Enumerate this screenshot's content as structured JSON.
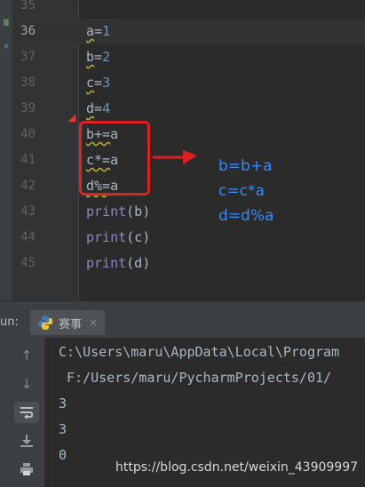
{
  "editor": {
    "lines": [
      {
        "num": "35",
        "parts": []
      },
      {
        "num": "36",
        "parts": [
          {
            "t": "a",
            "c": "warn"
          },
          {
            "t": "=",
            "c": ""
          },
          {
            "t": "1",
            "c": "num"
          }
        ]
      },
      {
        "num": "37",
        "parts": [
          {
            "t": "b",
            "c": "warn"
          },
          {
            "t": "=",
            "c": ""
          },
          {
            "t": "2",
            "c": "num"
          }
        ]
      },
      {
        "num": "38",
        "parts": [
          {
            "t": "c",
            "c": "warn"
          },
          {
            "t": "=",
            "c": ""
          },
          {
            "t": "3",
            "c": "num"
          }
        ]
      },
      {
        "num": "39",
        "parts": [
          {
            "t": "d",
            "c": "warn"
          },
          {
            "t": "=",
            "c": ""
          },
          {
            "t": "4",
            "c": "num"
          }
        ]
      },
      {
        "num": "40",
        "parts": [
          {
            "t": "b+=",
            "c": "warn"
          },
          {
            "t": "a",
            "c": ""
          }
        ]
      },
      {
        "num": "41",
        "parts": [
          {
            "t": "c*=",
            "c": "warn"
          },
          {
            "t": "a",
            "c": ""
          }
        ]
      },
      {
        "num": "42",
        "parts": [
          {
            "t": "d%=",
            "c": "warn"
          },
          {
            "t": "a",
            "c": ""
          }
        ]
      },
      {
        "num": "43",
        "parts": [
          {
            "t": "print",
            "c": "kw"
          },
          {
            "t": "(b)",
            "c": ""
          }
        ]
      },
      {
        "num": "44",
        "parts": [
          {
            "t": "print",
            "c": "kw"
          },
          {
            "t": "(c)",
            "c": ""
          }
        ]
      },
      {
        "num": "45",
        "parts": [
          {
            "t": "print",
            "c": "kw"
          },
          {
            "t": "(d)",
            "c": ""
          }
        ]
      }
    ],
    "current_line": "36"
  },
  "annotation": {
    "lines": [
      "b=b+a",
      "c=c*a",
      "d=d%a"
    ],
    "color": "#2f8cff",
    "box_color": "#e02020"
  },
  "run": {
    "label": "un:",
    "tab_label": "赛事",
    "tab_close": "×",
    "output": [
      "C:\\Users\\maru\\AppData\\Local\\Program",
      " F:/Users/maru/PycharmProjects/01/",
      "3",
      "3",
      "0"
    ]
  },
  "watermark": "https://blog.csdn.net/weixin_43909997"
}
